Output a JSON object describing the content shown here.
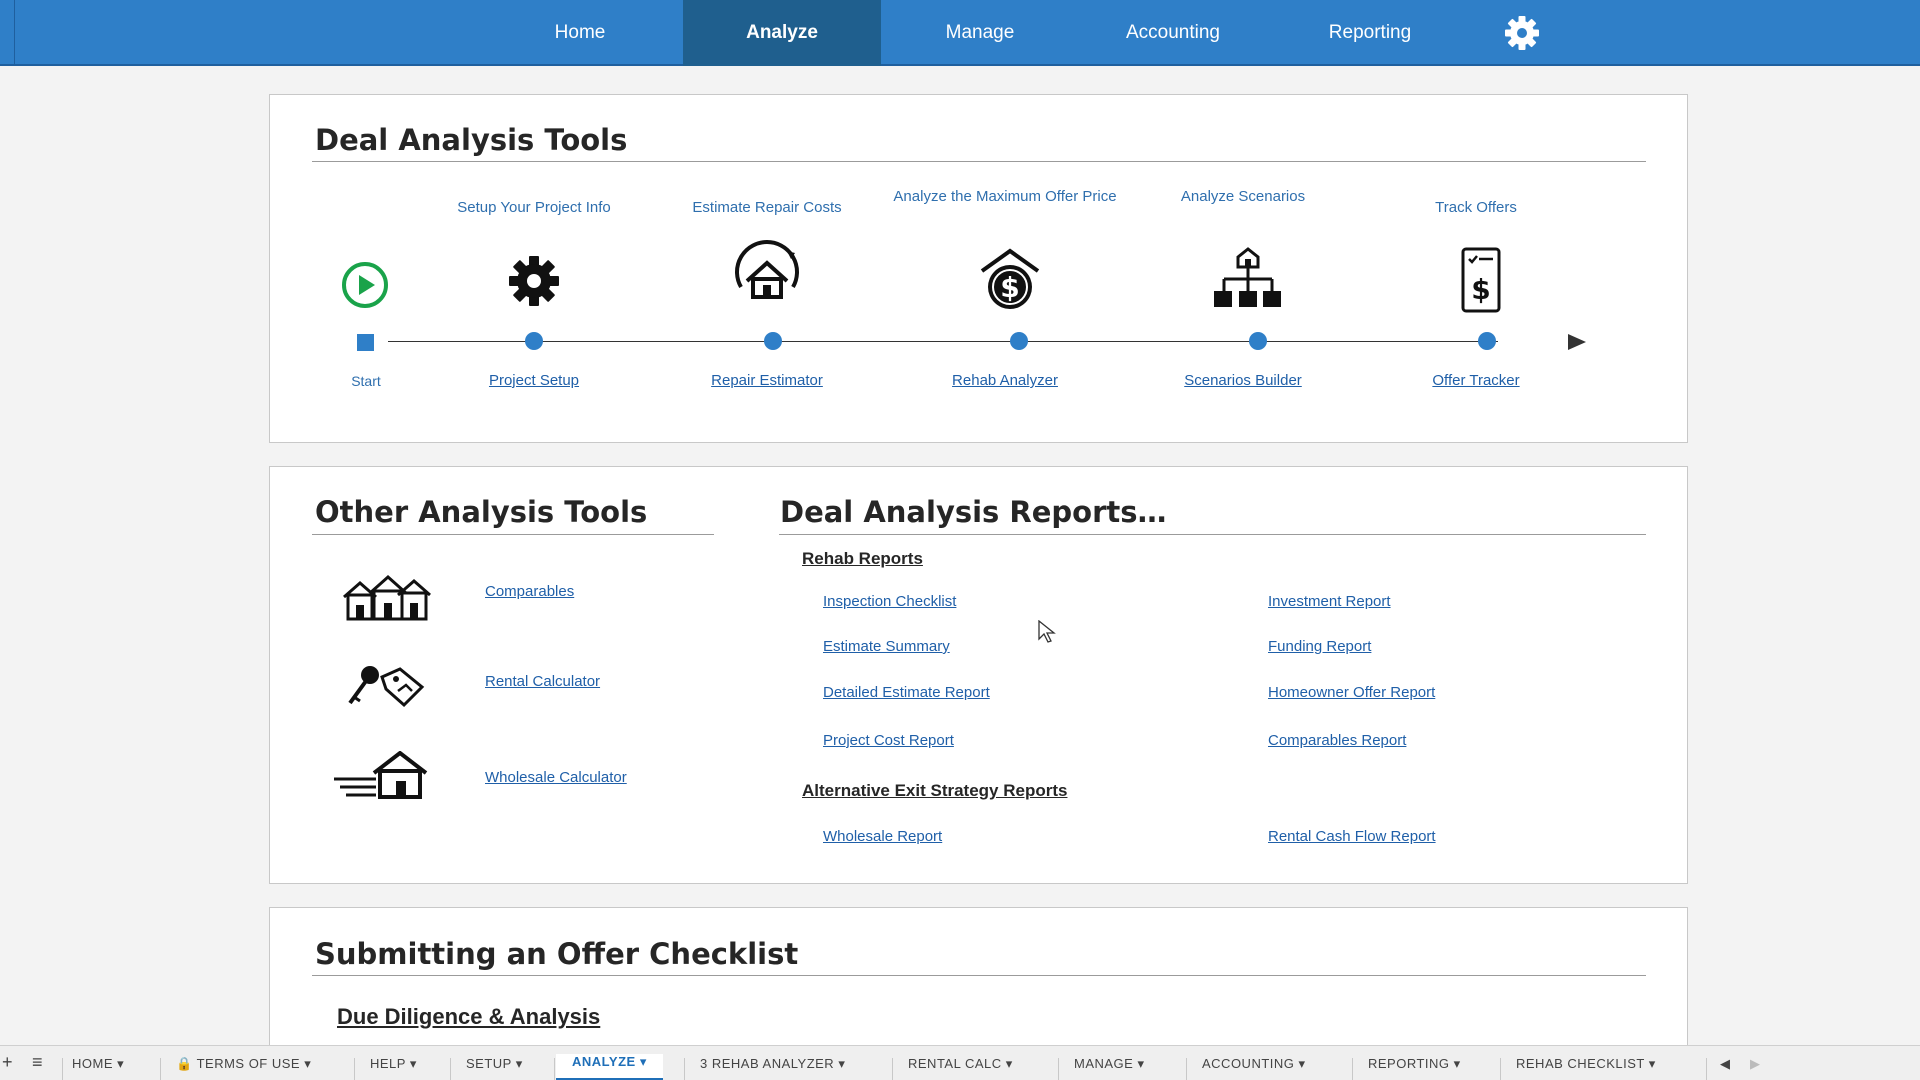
{
  "nav": {
    "items": [
      {
        "label": "Home"
      },
      {
        "label": "Analyze"
      },
      {
        "label": "Manage"
      },
      {
        "label": "Accounting"
      },
      {
        "label": "Reporting"
      }
    ],
    "active": "Analyze",
    "settings_icon": "gear-icon"
  },
  "deal_tools": {
    "title": "Deal Analysis Tools",
    "start_label": "Start",
    "steps": [
      {
        "caption": "Setup Your Project Info",
        "link": "Project Setup",
        "icon": "gear-icon"
      },
      {
        "caption": "Estimate Repair Costs",
        "link": "Repair Estimator",
        "icon": "house-repair-icon"
      },
      {
        "caption": "Analyze the Maximum Offer Price",
        "link": "Rehab Analyzer",
        "icon": "house-dollar-icon"
      },
      {
        "caption": "Analyze Scenarios",
        "link": "Scenarios Builder",
        "icon": "org-chart-icon"
      },
      {
        "caption": "Track Offers",
        "link": "Offer Tracker",
        "icon": "receipt-dollar-icon"
      }
    ]
  },
  "other_tools": {
    "title": "Other Analysis Tools",
    "items": [
      {
        "label": "Comparables",
        "icon": "houses-icon"
      },
      {
        "label": "Rental Calculator",
        "icon": "key-tag-icon"
      },
      {
        "label": "Wholesale Calculator",
        "icon": "fast-house-icon"
      }
    ]
  },
  "reports": {
    "title": "Deal Analysis Reports…",
    "rehab_heading": "Rehab Reports",
    "rehab_left": [
      "Inspection Checklist",
      "Estimate Summary",
      "Detailed Estimate Report",
      "Project Cost Report"
    ],
    "rehab_right": [
      "Investment Report",
      "Funding Report",
      "Homeowner Offer Report",
      "Comparables Report"
    ],
    "alt_heading": "Alternative Exit Strategy Reports",
    "alt_left": [
      "Wholesale Report"
    ],
    "alt_right": [
      "Rental Cash Flow Report"
    ]
  },
  "checklist": {
    "title": "Submitting an Offer Checklist",
    "subtitle": "Due Diligence & Analysis"
  },
  "sheet_tabs": [
    "HOME",
    "TERMS OF USE",
    "HELP",
    "SETUP",
    "ANALYZE",
    "3 REHAB ANALYZER",
    "RENTAL CALC",
    "MANAGE",
    "ACCOUNTING",
    "REPORTING",
    "REHAB CHECKLIST"
  ],
  "sheet_tabs_active": "ANALYZE",
  "colors": {
    "nav_bg": "#2f7fc8",
    "nav_active": "#1f5f8e",
    "link": "#1f5fa8",
    "start_green": "#1aa34a"
  }
}
